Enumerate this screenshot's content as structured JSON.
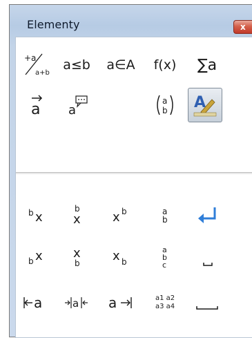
{
  "window": {
    "title": "Elementy",
    "close_label": "x"
  },
  "toolbar": {
    "row1": [
      {
        "name": "fraction-icon",
        "top": "+a",
        "bottom": "a+b"
      },
      {
        "name": "less-equal-icon",
        "text": "a≤b"
      },
      {
        "name": "element-of-icon",
        "text": "a∈A"
      },
      {
        "name": "function-icon",
        "text": "f(x)"
      },
      {
        "name": "sum-icon",
        "text": "∑a"
      }
    ],
    "row2": [
      {
        "name": "vector-icon",
        "text": "a"
      },
      {
        "name": "attribute-icon",
        "text": "a"
      },
      {
        "name": "brackets-icon",
        "top": "a",
        "bottom": "b"
      },
      {
        "name": "formatting-icon"
      }
    ]
  },
  "elements": {
    "row1": [
      {
        "name": "superscript-left-icon",
        "sup": "b",
        "base": "x"
      },
      {
        "name": "superscript-above-icon",
        "sup": "b",
        "base": "x"
      },
      {
        "name": "superscript-right-icon",
        "base": "x",
        "sup": "b"
      },
      {
        "name": "stack-two-icon",
        "top": "a",
        "bottom": "b"
      },
      {
        "name": "new-line-icon"
      }
    ],
    "row2": [
      {
        "name": "subscript-left-icon",
        "sub": "b",
        "base": "x"
      },
      {
        "name": "subscript-below-icon",
        "base": "x",
        "sub": "b"
      },
      {
        "name": "subscript-right-icon",
        "base": "x",
        "sub": "b"
      },
      {
        "name": "stack-three-icon",
        "top": "a",
        "middle": "b",
        "bottom": "c"
      },
      {
        "name": "small-gap-icon"
      }
    ],
    "row3": [
      {
        "name": "align-left-icon",
        "text": "a"
      },
      {
        "name": "align-center-icon",
        "text": "a"
      },
      {
        "name": "align-right-icon",
        "text": "a"
      },
      {
        "name": "matrix-icon",
        "top": "a1 a2",
        "bottom": "a3 a4"
      },
      {
        "name": "gap-icon"
      }
    ]
  }
}
